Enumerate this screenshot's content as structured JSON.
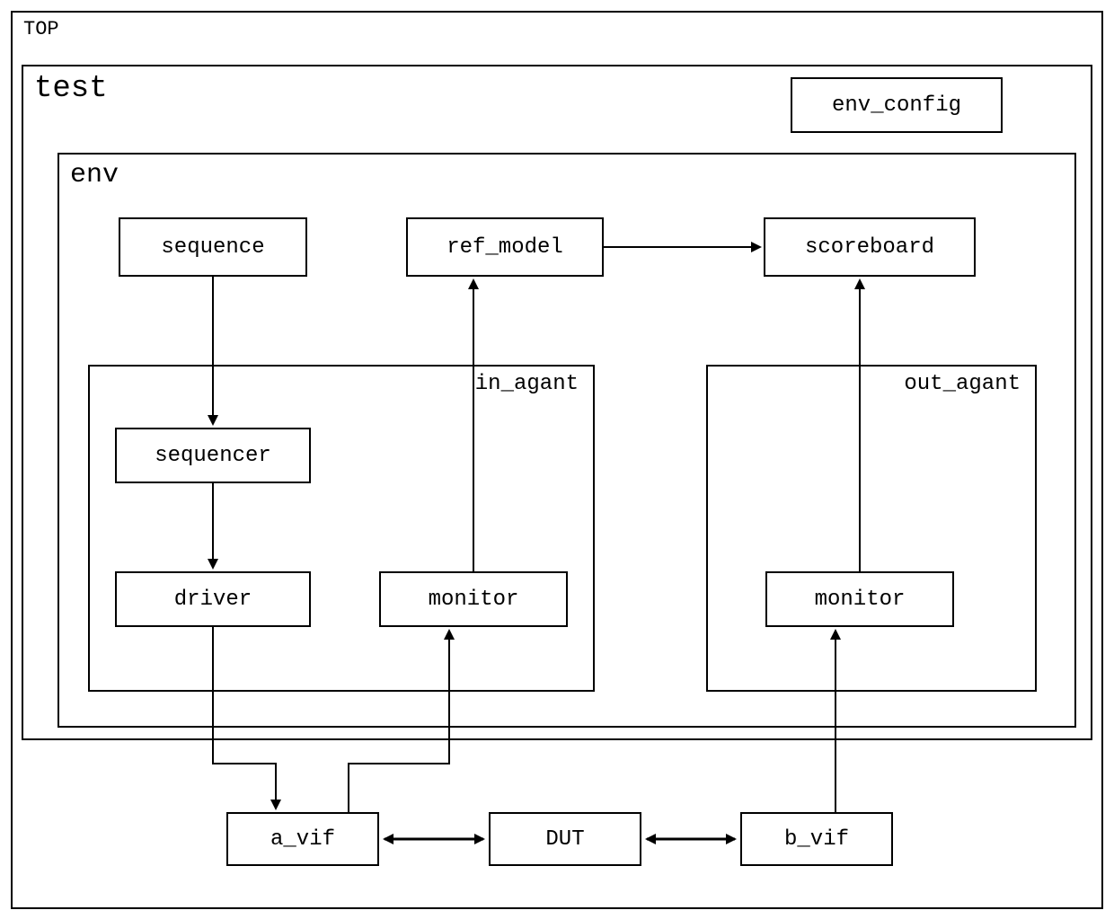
{
  "top": {
    "label": "TOP"
  },
  "test": {
    "label": "test"
  },
  "env_config": {
    "label": "env_config"
  },
  "env": {
    "label": "env"
  },
  "sequence": {
    "label": "sequence"
  },
  "ref_model": {
    "label": "ref_model"
  },
  "scoreboard": {
    "label": "scoreboard"
  },
  "in_agent": {
    "label": "in_agant",
    "sequencer": {
      "label": "sequencer"
    },
    "driver": {
      "label": "driver"
    },
    "monitor": {
      "label": "monitor"
    }
  },
  "out_agent": {
    "label": "out_agant",
    "monitor": {
      "label": "monitor"
    }
  },
  "a_vif": {
    "label": "a_vif"
  },
  "dut": {
    "label": "DUT"
  },
  "b_vif": {
    "label": "b_vif"
  }
}
